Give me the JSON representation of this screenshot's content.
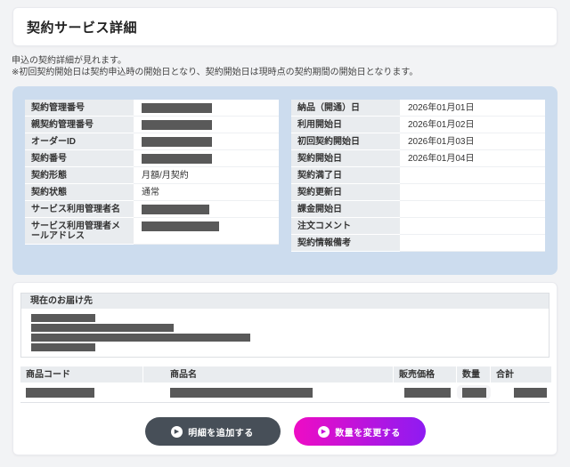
{
  "page_title": "契約サービス詳細",
  "description": {
    "line1": "申込の契約詳細が見れます。",
    "line2": "※初回契約開始日は契約申込時の開始日となり、契約開始日は現時点の契約期間の開始日となります。"
  },
  "contract": {
    "left_fields": [
      {
        "label": "契約管理番号",
        "value": "",
        "redacted": true,
        "redact_style": "width:79px"
      },
      {
        "label": "親契約管理番号",
        "value": "",
        "redacted": true,
        "redact_style": "width:79px"
      },
      {
        "label": "オーダーID",
        "value": "",
        "redacted": true,
        "redact_style": "width:79px"
      },
      {
        "label": "契約番号",
        "value": "",
        "redacted": true,
        "redact_style": "width:79px"
      },
      {
        "label": "契約形態",
        "value": "月額/月契約"
      },
      {
        "label": "契約状態",
        "value": "通常"
      },
      {
        "label": "サービス利用管理者名",
        "value": "",
        "redacted": true,
        "redact_style": "width:76px"
      },
      {
        "label": "サービス利用管理者メールアドレス",
        "value": "",
        "redacted": true,
        "redact_style": "width:87px"
      }
    ],
    "right_fields": [
      {
        "label": "納品（開通）日",
        "value": "2026年01月01日"
      },
      {
        "label": "利用開始日",
        "value": "2026年01月02日"
      },
      {
        "label": "初回契約開始日",
        "value": "2026年01月03日"
      },
      {
        "label": "契約開始日",
        "value": "2026年01月04日"
      },
      {
        "label": "契約満了日",
        "value": ""
      },
      {
        "label": "契約更新日",
        "value": ""
      },
      {
        "label": "課金開始日",
        "value": ""
      },
      {
        "label": "注文コメント",
        "value": ""
      },
      {
        "label": "契約情報備考",
        "value": ""
      }
    ]
  },
  "delivery": {
    "header": "現在のお届け先",
    "lines": [
      {
        "redact_style": "width:72px"
      },
      {
        "redact_style": "width:160px"
      },
      {
        "redact_style": "width:246px"
      },
      {
        "redact_style": "width:72px"
      }
    ]
  },
  "items": {
    "headers": {
      "code": "商品コード",
      "name": "商品名",
      "price": "販売価格",
      "qty": "数量",
      "total": "合計"
    },
    "row": {
      "code_redact": "width:77px;margin-left:6px",
      "name_redact": "width:160px;margin-left:30px",
      "price_redact": "width:52px;margin-left:12px",
      "total_redact": "width:37px;margin-left:26px"
    }
  },
  "actions": {
    "add_detail": "明細を追加する",
    "change_qty": "数量を変更する",
    "arrow_icon": "▶"
  },
  "colors": {
    "panel_blue": "#ccdcee",
    "label_gray": "#e9ecef",
    "redact_gray": "#595959",
    "button_dark": "#474f58",
    "gradient_start": "#ee0cc4",
    "gradient_end": "#8e1bf2",
    "page_bg": "#f2f3f5"
  }
}
